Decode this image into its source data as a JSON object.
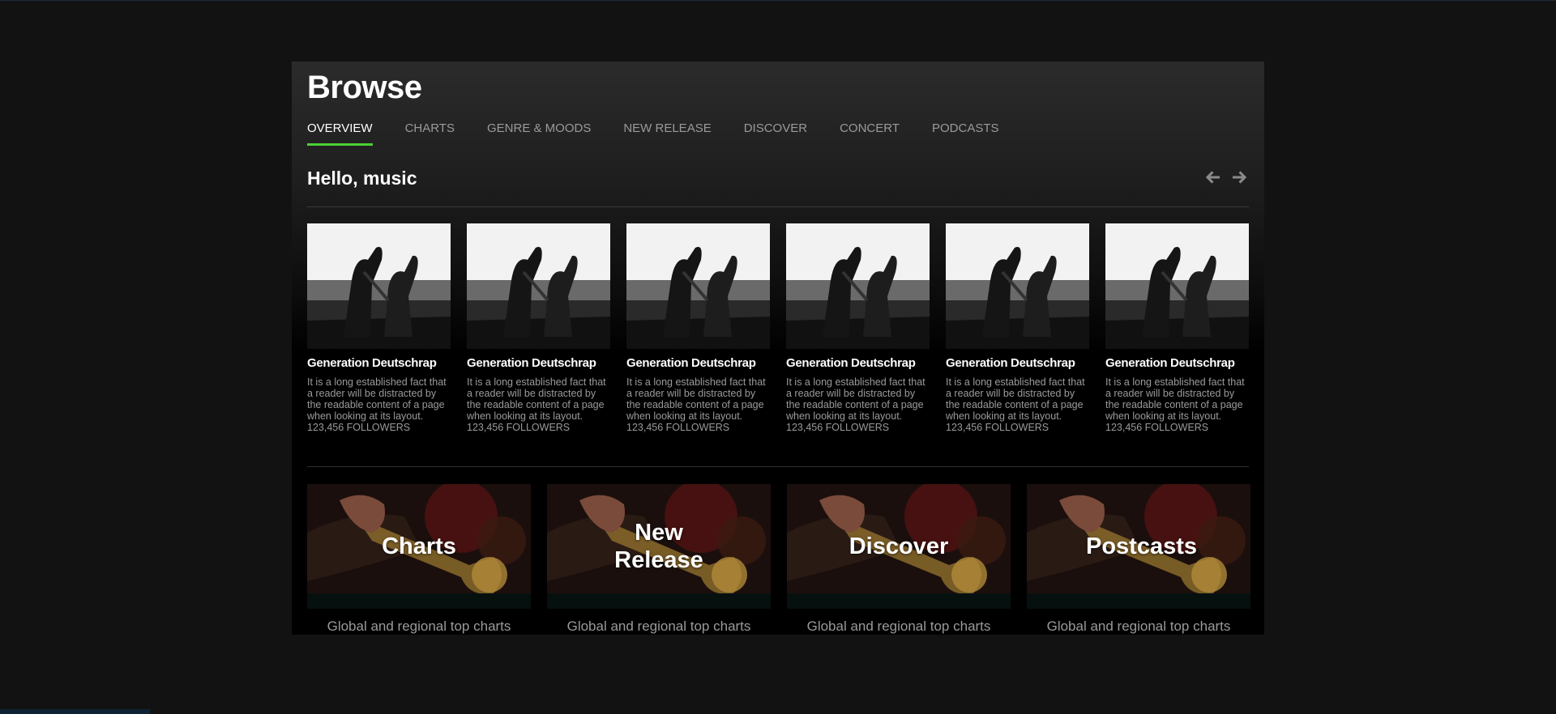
{
  "page": {
    "title": "Browse"
  },
  "tabs": [
    {
      "label": "OVERVIEW",
      "active": true
    },
    {
      "label": "CHARTS"
    },
    {
      "label": "GENRE & MOODS"
    },
    {
      "label": "NEW RELEASE"
    },
    {
      "label": "DISCOVER"
    },
    {
      "label": "CONCERT"
    },
    {
      "label": "PODCASTS"
    }
  ],
  "section": {
    "title": "Hello, music"
  },
  "cards": [
    {
      "title": "Generation Deutschrap",
      "description": "It is a long established fact that a reader will be distracted by the readable content of a page when looking at its layout.",
      "followers": "123,456 FOLLOWERS"
    },
    {
      "title": "Generation Deutschrap",
      "description": "It is a long established fact that a reader will be distracted by the readable content of a page when looking at its layout.",
      "followers": "123,456 FOLLOWERS"
    },
    {
      "title": "Generation Deutschrap",
      "description": "It is a long established fact that a reader will be distracted by the readable content of a page when looking at its layout.",
      "followers": "123,456 FOLLOWERS"
    },
    {
      "title": "Generation Deutschrap",
      "description": "It is a long established fact that a reader will be distracted by the readable content of a page when looking at its layout.",
      "followers": "123,456 FOLLOWERS"
    },
    {
      "title": "Generation Deutschrap",
      "description": "It is a long established fact that a reader will be distracted by the readable content of a page when looking at its layout.",
      "followers": "123,456 FOLLOWERS"
    },
    {
      "title": "Generation Deutschrap",
      "description": "It is a long established fact that a reader will be distracted by the readable content of a page when looking at its layout.",
      "followers": "123,456 FOLLOWERS"
    }
  ],
  "tiles": [
    {
      "label": "Charts",
      "subtitle": "Global and regional top charts"
    },
    {
      "label": "New Release",
      "subtitle": "Global and regional top charts"
    },
    {
      "label": "Discover",
      "subtitle": "Global and regional top charts"
    },
    {
      "label": "Postcasts",
      "subtitle": "Global and regional top charts"
    }
  ],
  "icons": {
    "prev": "arrow-left-icon",
    "next": "arrow-right-icon"
  },
  "colors": {
    "accent": "#4cd137",
    "background": "#121212",
    "muted_text": "#9a9a9a"
  }
}
